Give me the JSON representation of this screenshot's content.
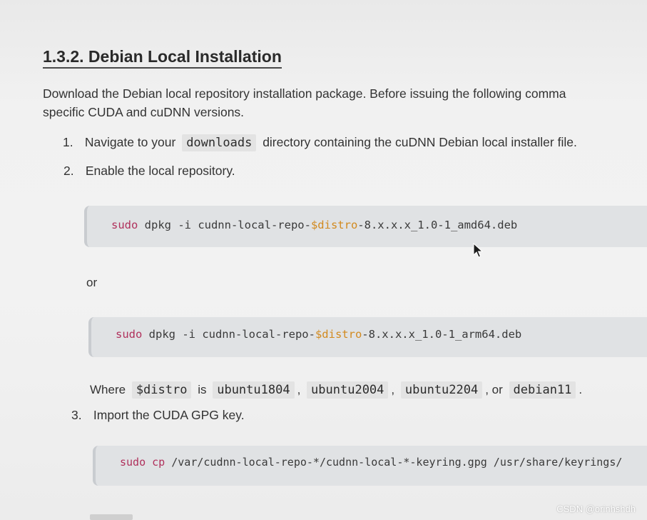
{
  "heading": "1.3.2. Debian Local Installation",
  "intro": {
    "line1": "Download the Debian local repository installation package. Before issuing the following comma",
    "line2": "specific CUDA and cuDNN versions."
  },
  "steps": [
    {
      "number": "1.",
      "before": "Navigate to your",
      "code": "downloads",
      "after": "directory containing the cuDNN Debian local installer file."
    },
    {
      "number": "2.",
      "text": "Enable the local repository."
    },
    {
      "number": "3.",
      "text": "Import the CUDA GPG key."
    }
  ],
  "code_blocks": [
    {
      "cmd": "sudo",
      "prefix": " dpkg -i cudnn-local-repo-",
      "var": "$distro",
      "suffix": "-8.x.x.x_1.0-1_amd64.deb"
    },
    {
      "cmd": "sudo",
      "prefix": " dpkg -i cudnn-local-repo-",
      "var": "$distro",
      "suffix": "-8.x.x.x_1.0-1_arm64.deb"
    },
    {
      "cmd": "sudo cp",
      "prefix": " /var/cudnn-local-repo-*/cudnn-local-*-keyring.gpg /usr/share/keyrings/",
      "var": "",
      "suffix": ""
    }
  ],
  "or_text": "or",
  "where": {
    "label": "Where",
    "var": "$distro",
    "is": "is",
    "options": [
      "ubuntu1804",
      "ubuntu2004",
      "ubuntu2204",
      "debian11"
    ],
    "comma": ",",
    "or": ", or",
    "period": "."
  },
  "watermark": "CSDN @orinhshdh",
  "colors": {
    "command_keyword": "#b0315c",
    "variable": "#d28a1f",
    "code_background": "#e0e2e4",
    "inline_code_background": "#e3e3e3"
  }
}
